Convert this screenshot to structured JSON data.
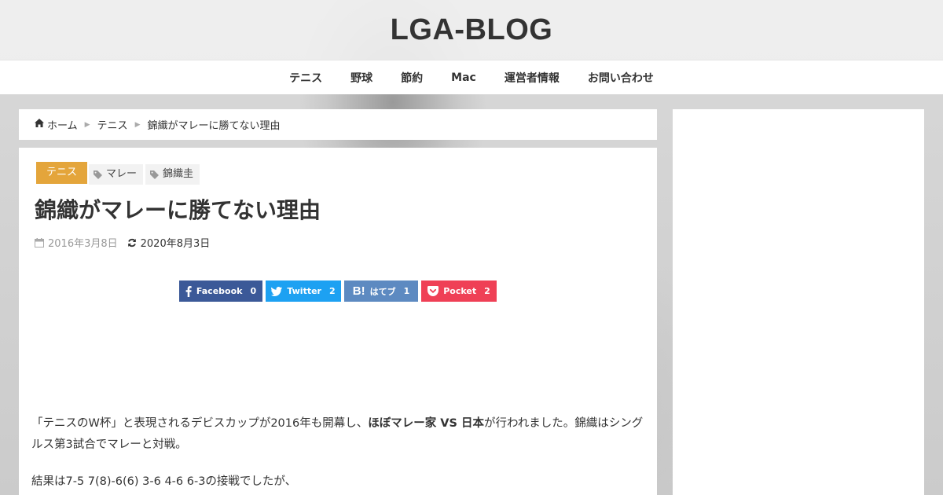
{
  "site": {
    "title": "LGA-BLOG"
  },
  "nav": {
    "items": [
      {
        "label": "テニス"
      },
      {
        "label": "野球"
      },
      {
        "label": "節約"
      },
      {
        "label": "Mac"
      },
      {
        "label": "運営者情報"
      },
      {
        "label": "お問い合わせ"
      }
    ]
  },
  "breadcrumb": {
    "home": "ホーム",
    "category": "テニス",
    "current": "錦織がマレーに勝てない理由"
  },
  "article": {
    "category": "テニス",
    "tags": [
      "マレー",
      "錦織圭"
    ],
    "title": "錦織がマレーに勝てない理由",
    "date_posted": "2016年3月8日",
    "date_updated": "2020年8月3日",
    "share": {
      "facebook": {
        "label": "Facebook",
        "count": "0"
      },
      "twitter": {
        "label": "Twitter",
        "count": "2"
      },
      "hatena": {
        "icon": "B!",
        "label": "はてブ",
        "count": "1"
      },
      "pocket": {
        "label": "Pocket",
        "count": "2"
      }
    },
    "paragraph1": {
      "before": "「テニスのW杯」と表現されるデビスカップが2016年も開幕し、",
      "bold": "ほぼマレー家 VS 日本",
      "after": "が行われました。錦織はシングルス第3試合でマレーと対戦。"
    },
    "paragraph2": "結果は7-5 7(8)-6(6) 3-6 4-6 6-3の接戦でしたが、"
  },
  "colors": {
    "category": "#e4a53b",
    "facebook": "#3b5998",
    "twitter": "#1da1f2",
    "hatena": "#5d8ac1",
    "pocket": "#ef4056"
  },
  "icons": {
    "home": "home-icon",
    "tag": "tag-icon",
    "calendar": "calendar-icon",
    "refresh": "refresh-icon",
    "facebook": "facebook-icon",
    "twitter": "twitter-icon",
    "pocket": "pocket-icon"
  }
}
